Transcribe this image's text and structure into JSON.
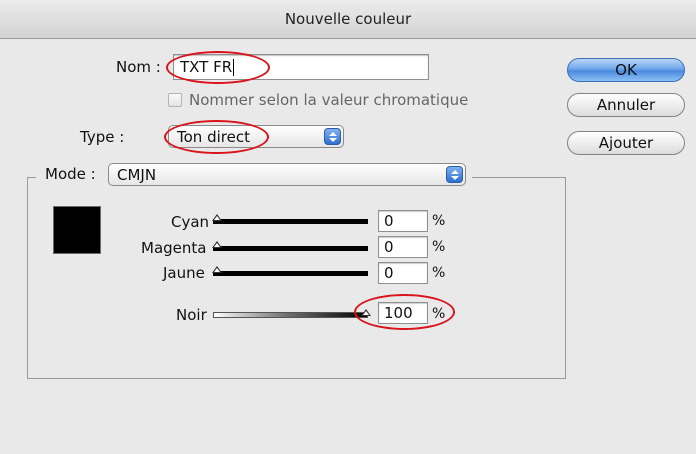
{
  "window": {
    "title": "Nouvelle couleur"
  },
  "name_row": {
    "label": "Nom :",
    "value": "TXT FR"
  },
  "checkbox": {
    "label": "Nommer selon la valeur chromatique",
    "checked": false
  },
  "type_row": {
    "label": "Type :",
    "value": "Ton direct"
  },
  "mode_row": {
    "label": "Mode :",
    "value": "CMJN"
  },
  "buttons": {
    "ok": "OK",
    "cancel": "Annuler",
    "add": "Ajouter"
  },
  "swatch": {
    "color": "#000000"
  },
  "sliders": [
    {
      "label": "Cyan",
      "value": "0",
      "unit": "%"
    },
    {
      "label": "Magenta",
      "value": "0",
      "unit": "%"
    },
    {
      "label": "Jaune",
      "value": "0",
      "unit": "%"
    },
    {
      "label": "Noir",
      "value": "100",
      "unit": "%"
    }
  ],
  "colors": {
    "highlight_ellipse": "#d8141c",
    "default_button": "#4a8ae0"
  }
}
